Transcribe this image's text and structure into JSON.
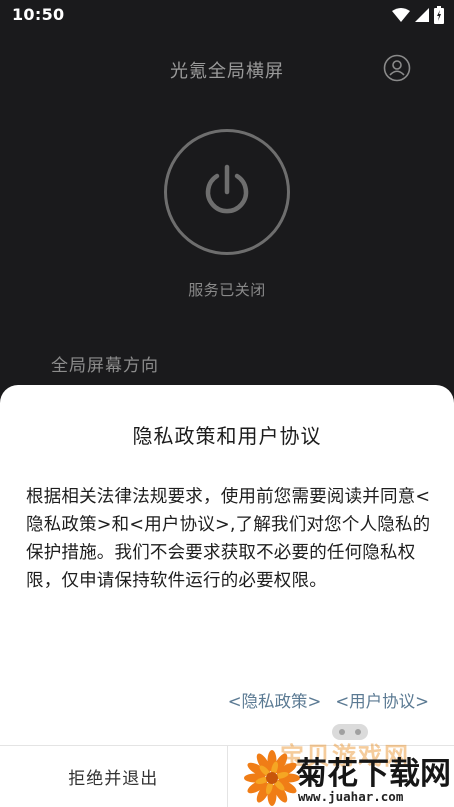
{
  "status_bar": {
    "time": "10:50",
    "icons": [
      "wifi-icon",
      "cellular-icon",
      "battery-icon"
    ]
  },
  "app": {
    "title": "光氪全局横屏",
    "user_icon": "user-profile-icon",
    "power_icon": "power-icon",
    "service_status": "服务已关闭",
    "section_label": "全局屏幕方向"
  },
  "dialog": {
    "title": "隐私政策和用户协议",
    "body": "根据相关法律法规要求，使用前您需要阅读并同意<隐私政策>和<用户协议>,了解我们对您个人隐私的保护措施。我们不会要求获取不必要的任何隐私权限，仅申请保持软件运行的必要权限。",
    "privacy_link": "<隐私政策>",
    "user_agreement_link": "<用户协议>",
    "reject_button": "拒绝并退出",
    "accept_button": ""
  },
  "watermark": {
    "ghost_text": "宝贝游戏网",
    "brand": "菊花下载网",
    "url": "www.juahar.com"
  },
  "colors": {
    "app_background": "#1a1a1c",
    "dialog_background": "#ffffff",
    "link": "#5b7a93",
    "watermark_orange": "#e98d24"
  }
}
